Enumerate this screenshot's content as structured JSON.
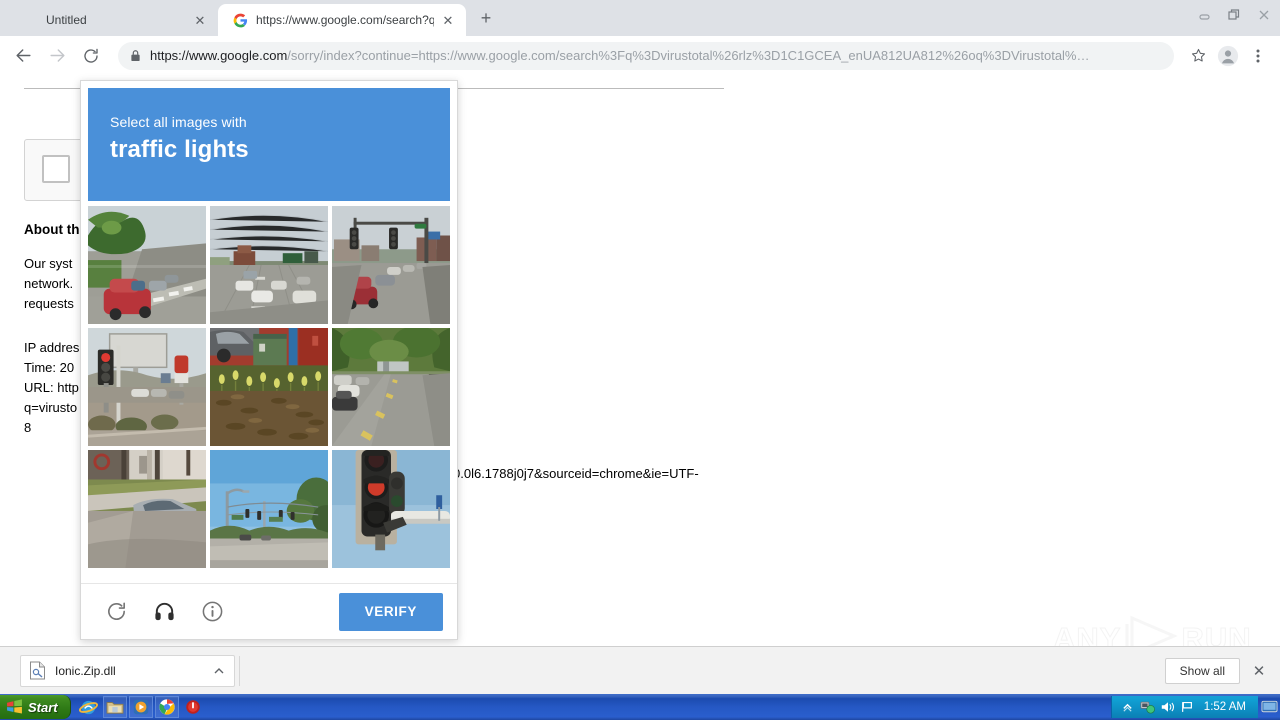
{
  "browser": {
    "tabs": [
      {
        "title": "Untitled",
        "favicon": "none",
        "active": false
      },
      {
        "title": "https://www.google.com/search?q=",
        "favicon": "google-icon",
        "active": true
      }
    ],
    "new_tab_label": "+",
    "close_glyph": "✕",
    "window_controls": {
      "minimize": "minimize-icon",
      "restore": "restore-icon",
      "close": "close-icon"
    },
    "toolbar": {
      "back": "back-arrow-icon",
      "forward": "forward-arrow-icon",
      "reload": "reload-icon",
      "lock": "lock-icon",
      "url_host": "https://www.google.com",
      "url_path": "/sorry/index?continue=https://www.google.com/search%3Fq%3Dvirustotal%26rlz%3D1C1GCEA_enUA812UA812%26oq%3DVirustotal%…",
      "bookmark": "star-icon",
      "profile": "avatar-icon",
      "menu": "three-dot-menu-icon"
    }
  },
  "page": {
    "heading": "About th",
    "body": "Our syst\nnetwork.\nrequests",
    "meta": "IP addres\nTime: 20\nURL: http\nq=virusto\n8",
    "url_tail": "0.0l6.1788j0j7&sourceid=chrome&ie=UTF-"
  },
  "captcha": {
    "prompt_line1": "Select all images with",
    "prompt_line2": "traffic lights",
    "header_color": "#4a90d9",
    "tiles": [
      {
        "index": 1,
        "scene": "suburban-street-red-car"
      },
      {
        "index": 2,
        "scene": "wide-highway-cars"
      },
      {
        "index": 3,
        "scene": "intersection-with-traffic-lights"
      },
      {
        "index": 4,
        "scene": "roadside-traffic-signal-billboard"
      },
      {
        "index": 5,
        "scene": "dumpster-flowerbed-red-wall"
      },
      {
        "index": 6,
        "scene": "tree-lined-residential-street"
      },
      {
        "index": 7,
        "scene": "driveway-parked-silver-car"
      },
      {
        "index": 8,
        "scene": "open-road-blue-sky-signals"
      },
      {
        "index": 9,
        "scene": "closeup-traffic-light-mast"
      }
    ],
    "footer": {
      "reload": "reload-icon",
      "audio": "headphones-icon",
      "info": "info-icon",
      "verify_label": "VERIFY"
    }
  },
  "watermark": {
    "left": "ANY",
    "right": "RUN"
  },
  "downloads": {
    "item_name": "Ionic.Zip.dll",
    "item_icon": "dll-file-icon",
    "caret": "chevron-up-icon",
    "show_all_label": "Show all",
    "close_glyph": "✕"
  },
  "taskbar": {
    "start_label": "Start",
    "quick_launch": [
      "internet-explorer-icon",
      "folder-icon",
      "media-player-icon",
      "chrome-icon",
      "shield-icon"
    ],
    "tray": {
      "chevron": "tray-chevron-icon",
      "network": "network-icon",
      "volume": "volume-icon",
      "flag": "flag-icon",
      "clock": "1:52 AM",
      "desktop": "show-desktop-icon"
    }
  }
}
